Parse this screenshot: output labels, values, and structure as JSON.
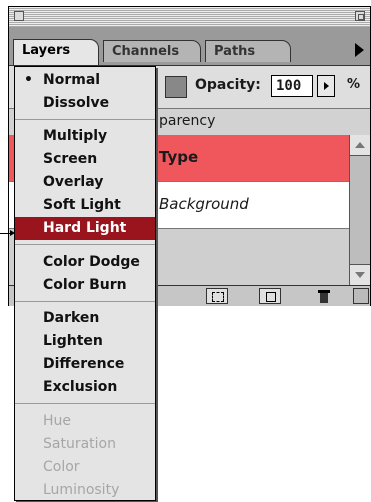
{
  "palette": {
    "tabs": [
      {
        "label": "Layers",
        "active": true
      },
      {
        "label": "Channels",
        "active": false
      },
      {
        "label": "Paths",
        "active": false
      }
    ],
    "opacity_label": "Opacity:",
    "opacity_value": "100",
    "percent_sign": "%",
    "preserve_label": "parency",
    "layers": [
      {
        "name": "Type",
        "selected": true,
        "color": "#f0575c"
      },
      {
        "name": "Background",
        "selected": false
      }
    ],
    "selected_color": "#99141c"
  },
  "blend_menu": {
    "current": "Normal",
    "items": [
      {
        "label": "Normal",
        "checked": true
      },
      {
        "label": "Dissolve"
      },
      {
        "label": "Multiply"
      },
      {
        "label": "Screen"
      },
      {
        "label": "Overlay"
      },
      {
        "label": "Soft Light"
      },
      {
        "label": "Hard Light",
        "highlighted": true
      },
      {
        "label": "Color Dodge"
      },
      {
        "label": "Color Burn"
      },
      {
        "label": "Darken"
      },
      {
        "label": "Lighten"
      },
      {
        "label": "Difference"
      },
      {
        "label": "Exclusion"
      },
      {
        "label": "Hue",
        "disabled": true
      },
      {
        "label": "Saturation",
        "disabled": true
      },
      {
        "label": "Color",
        "disabled": true
      },
      {
        "label": "Luminosity",
        "disabled": true
      }
    ],
    "check_glyph": "•"
  }
}
